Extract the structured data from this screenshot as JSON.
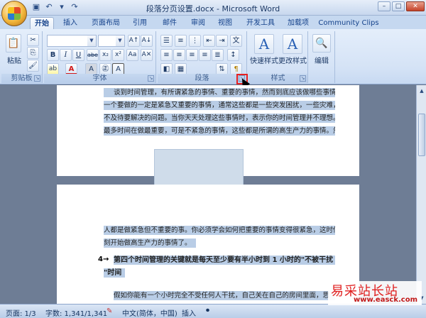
{
  "window": {
    "title": "段落分页设置.docx - Microsoft Word"
  },
  "tabs": [
    "开始",
    "插入",
    "页面布局",
    "引用",
    "邮件",
    "审阅",
    "视图",
    "开发工具",
    "加载项",
    "Community Clips"
  ],
  "ribbon": {
    "clipboard": {
      "paste": "粘贴",
      "label": "剪贴板"
    },
    "font": {
      "label": "字体",
      "bold": "B",
      "italic": "I",
      "underline": "U",
      "strike": "abe",
      "sub": "x₂",
      "sup": "x²",
      "aa": "Aa",
      "text_color": "A",
      "highlight": "ab",
      "char_border": "A",
      "circle": "㊣",
      "phonetic": "A"
    },
    "paragraph": {
      "label": "段落"
    },
    "styles": {
      "quick": "快速样式",
      "change": "更改样式",
      "label": "样式"
    },
    "editing": {
      "label": "编辑"
    }
  },
  "document": {
    "page1_lines": [
      "谈到时间管理，有所谓紧急的事情、重要的事情，然而到底应该做哪些事情?当然第",
      "一个要做的一定是紧急又重要的事情，通常这些都是一些突发困扰，一些灾难，一些迫",
      "不及待要解决的问题。当你天天处理这些事情时，表示你的时间管理并不理想。成功者花",
      "最多时间在做最重要，可是不紧急的事情，这些都是所谓的高生产力的事情。然而一般"
    ],
    "page2_lines": [
      "人都是做紧急但不重要的事。你必须学会如何把重要的事情变得很紧急，这时你就会立",
      "刻开始做高生产力的事情了。",
      "第四个时间管理的关键就是每天至少要有半小时到 1 小时的\"不被干扰",
      "\"时间",
      "假如你能有一个小时完全不受任何人干扰，自己关在自己的房间里面，思"
    ],
    "bullet": "4→"
  },
  "status": {
    "page": "页面: 1/3",
    "words": "字数: 1,341/1,341",
    "lang": "中文(简体，中国)",
    "mode": "插入"
  },
  "watermark": {
    "cn": "易采站长站",
    "url": "www.easck.com"
  }
}
